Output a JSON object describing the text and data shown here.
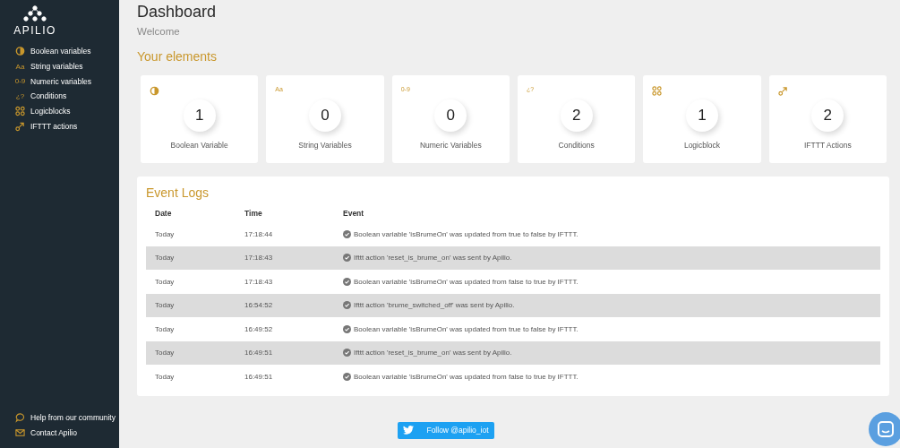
{
  "sidebar": {
    "logo": "APILIO",
    "items": [
      {
        "kind": "toggle",
        "label": "Boolean variables"
      },
      {
        "kind": "text",
        "icon_text": "Aa",
        "label": "String variables"
      },
      {
        "kind": "text",
        "icon_text": "0-9",
        "label": "Numeric variables"
      },
      {
        "kind": "text",
        "icon_text": "¿?",
        "label": "Conditions"
      },
      {
        "kind": "logic",
        "label": "Logicblocks"
      },
      {
        "kind": "action",
        "label": "IFTTT actions"
      }
    ],
    "footer": [
      {
        "kind": "chat",
        "label": "Help from our community"
      },
      {
        "kind": "mail",
        "label": "Contact Apilio"
      }
    ]
  },
  "header": {
    "title": "Dashboard",
    "subtitle": "Welcome"
  },
  "elements": {
    "title": "Your elements",
    "cards": [
      {
        "kind": "toggle",
        "count": "1",
        "label": "Boolean Variable"
      },
      {
        "kind": "text",
        "icon_text": "Aa",
        "count": "0",
        "label": "String Variables"
      },
      {
        "kind": "text",
        "icon_text": "0-9",
        "count": "0",
        "label": "Numeric Variables"
      },
      {
        "kind": "text",
        "icon_text": "¿?",
        "count": "2",
        "label": "Conditions"
      },
      {
        "kind": "logic",
        "count": "1",
        "label": "Logicblock"
      },
      {
        "kind": "action",
        "count": "2",
        "label": "IFTTT Actions"
      }
    ]
  },
  "event_logs": {
    "title": "Event Logs",
    "columns": [
      "Date",
      "Time",
      "Event"
    ],
    "rows": [
      {
        "date": "Today",
        "time": "17:18:44",
        "event": "Boolean variable 'isBrumeOn' was updated from true to false by IFTTT."
      },
      {
        "date": "Today",
        "time": "17:18:43",
        "event": "Ifttt action 'reset_is_brume_on' was sent by Apilio."
      },
      {
        "date": "Today",
        "time": "17:18:43",
        "event": "Boolean variable 'isBrumeOn' was updated from false to true by IFTTT."
      },
      {
        "date": "Today",
        "time": "16:54:52",
        "event": "Ifttt action 'brume_switched_off' was sent by Apilio."
      },
      {
        "date": "Today",
        "time": "16:49:52",
        "event": "Boolean variable 'isBrumeOn' was updated from true to false by IFTTT."
      },
      {
        "date": "Today",
        "time": "16:49:51",
        "event": "Ifttt action 'reset_is_brume_on' was sent by Apilio."
      },
      {
        "date": "Today",
        "time": "16:49:51",
        "event": "Boolean variable 'isBrumeOn' was updated from false to true by IFTTT."
      }
    ]
  },
  "follow_button": "Follow @apilio_iot"
}
